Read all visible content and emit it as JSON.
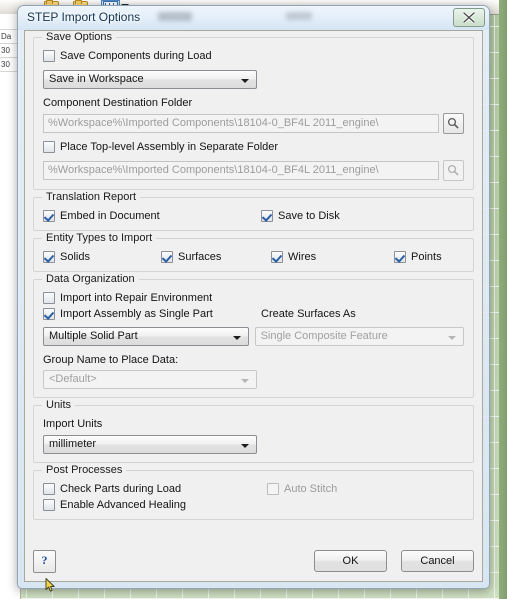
{
  "background": {
    "panel_cells": [
      "Da",
      "30",
      "30"
    ],
    "toolbar_icons": [
      "folder-open-icon",
      "folder-open-icon",
      "grid-table-icon",
      "dropdown-caret-icon"
    ]
  },
  "dialog": {
    "title": "STEP Import Options",
    "close_label": "Close",
    "save_options": {
      "legend": "Save Options",
      "save_components_during_load": {
        "label": "Save Components during Load",
        "checked": false,
        "enabled": true
      },
      "save_location": {
        "value": "Save in Workspace",
        "enabled": true
      },
      "component_destination_label": "Component Destination Folder",
      "component_destination_path": {
        "value": "%Workspace%\\Imported Components\\18104-0_BF4L 2011_engine\\",
        "enabled": false
      },
      "place_toplevel_assembly": {
        "label": "Place Top-level Assembly in Separate Folder",
        "checked": false,
        "enabled": true
      },
      "toplevel_path": {
        "value": "%Workspace%\\Imported Components\\18104-0_BF4L 2011_engine\\",
        "enabled": false
      },
      "browse_icon": "magnifier-icon"
    },
    "translation_report": {
      "legend": "Translation Report",
      "embed_in_document": {
        "label": "Embed in Document",
        "checked": true,
        "enabled": true
      },
      "save_to_disk": {
        "label": "Save to Disk",
        "checked": true,
        "enabled": true
      }
    },
    "entity_types": {
      "legend": "Entity Types to Import",
      "items": [
        {
          "label": "Solids",
          "checked": true,
          "enabled": true
        },
        {
          "label": "Surfaces",
          "checked": true,
          "enabled": true
        },
        {
          "label": "Wires",
          "checked": true,
          "enabled": true
        },
        {
          "label": "Points",
          "checked": true,
          "enabled": true
        }
      ]
    },
    "data_organization": {
      "legend": "Data Organization",
      "import_into_repair_environment": {
        "label": "Import into Repair Environment",
        "checked": false,
        "enabled": true
      },
      "import_assembly_as_single_part": {
        "label": "Import Assembly as Single Part",
        "checked": true,
        "enabled": true
      },
      "create_surfaces_as_label": "Create Surfaces As",
      "part_mode": {
        "value": "Multiple Solid Part",
        "enabled": true
      },
      "create_surfaces_as": {
        "value": "Single Composite Feature",
        "enabled": false
      },
      "group_name_label": "Group Name to Place Data:",
      "group_name": {
        "value": "<Default>",
        "enabled": false
      }
    },
    "units": {
      "legend": "Units",
      "import_units_label": "Import Units",
      "import_units": {
        "value": "millimeter",
        "enabled": true
      }
    },
    "post_processes": {
      "legend": "Post Processes",
      "check_parts_during_load": {
        "label": "Check Parts during Load",
        "checked": false,
        "enabled": true
      },
      "enable_advanced_healing": {
        "label": "Enable Advanced Healing",
        "checked": false,
        "enabled": true
      },
      "auto_stitch": {
        "label": "Auto Stitch",
        "checked": false,
        "enabled": false
      }
    },
    "footer": {
      "help_label": "?",
      "ok_label": "OK",
      "cancel_label": "Cancel"
    }
  },
  "colors": {
    "check_blue": "#2a5fa5",
    "dialog_face": "#f0f0f0",
    "glass": "#dbe8f5",
    "viewport_green": "#bed3ae",
    "disabled_text": "#9c9c9c"
  }
}
